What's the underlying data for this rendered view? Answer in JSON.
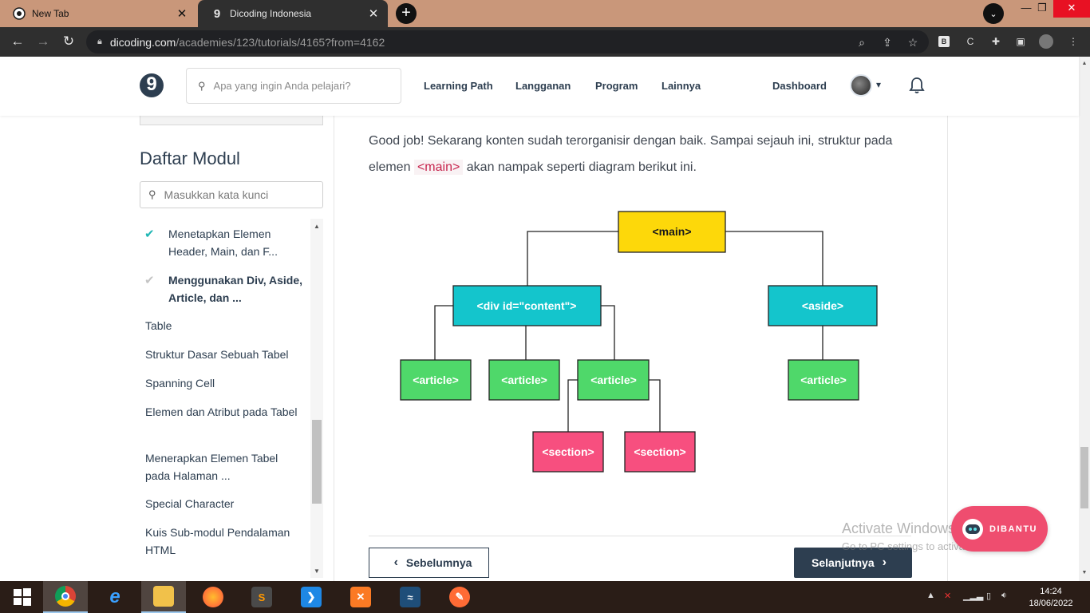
{
  "browser": {
    "tabs": [
      {
        "title": "New Tab"
      },
      {
        "title": "Dicoding Indonesia"
      }
    ],
    "url_host": "dicoding.com",
    "url_path": "/academies/123/tutorials/4165?from=4162"
  },
  "header": {
    "logo": "9",
    "search_placeholder": "Apa yang ingin Anda pelajari?",
    "nav": [
      "Learning Path",
      "Langganan",
      "Program",
      "Lainnya"
    ],
    "dashboard": "Dashboard"
  },
  "sidebar": {
    "title": "Daftar Modul",
    "search_placeholder": "Masukkan kata kunci",
    "items": [
      {
        "label": "Menetapkan Elemen Header, Main, dan F...",
        "status": "done"
      },
      {
        "label": "Menggunakan Div, Aside, Article, dan ...",
        "status": "current"
      },
      {
        "label": "Table"
      },
      {
        "label": "Struktur Dasar Sebuah Tabel"
      },
      {
        "label": "Spanning Cell"
      },
      {
        "label": "Elemen dan Atribut pada Tabel"
      },
      {
        "label": "Menerapkan Elemen Tabel pada Halaman ..."
      },
      {
        "label": "Special Character"
      },
      {
        "label": "Kuis Sub-modul Pendalaman HTML"
      }
    ]
  },
  "content": {
    "para_before": "Good job! Sekarang konten sudah terorganisir dengan baik. Sampai sejauh ini, struktur pada elemen",
    "para_code": "<main>",
    "para_after": "akan nampak seperti diagram berikut ini.",
    "diagram": {
      "main": "<main>",
      "div": "<div id=\"content\">",
      "aside": "<aside>",
      "article": "<article>",
      "section": "<section>"
    },
    "prev_label": "Sebelumnya",
    "next_label": "Selanjutnya"
  },
  "overlay": {
    "watermark_title": "Activate Windows",
    "watermark_sub": "Go to PC settings to activate Windows.",
    "dibantu": "DIBANTU"
  },
  "taskbar": {
    "time": "14:24",
    "date": "18/06/2022"
  },
  "colors": {
    "main_box": "#fdd80a",
    "cyan_box": "#14c5cc",
    "green_box": "#4fd86a",
    "pink_box": "#f74f7f",
    "brand_dark": "#2d3e50"
  }
}
